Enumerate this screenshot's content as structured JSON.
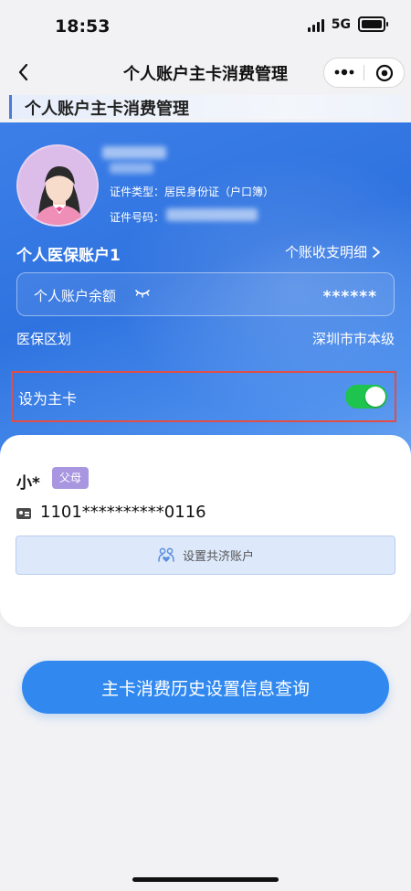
{
  "status_bar": {
    "time": "18:53",
    "network": "5G"
  },
  "nav": {
    "title": "个人账户主卡消费管理"
  },
  "subheader": {
    "title": "个人账户主卡消费管理"
  },
  "profile": {
    "id_type": "证件类型：居民身份证（户口簿）",
    "id_number_label": "证件号码："
  },
  "account": {
    "name": "个人医保账户1",
    "detail_link": "个账收支明细",
    "balance_label": "个人账户余额",
    "balance_value": "******",
    "region_label": "医保区划",
    "region_value": "深圳市市本级"
  },
  "main_card": {
    "label": "设为主卡",
    "enabled": true
  },
  "member": {
    "name": "小*",
    "relation": "父母",
    "id_number": "1101**********0116",
    "shared_button": "设置共济账户"
  },
  "query_button": "主卡消费历史设置信息查询",
  "colors": {
    "primary": "#3189f0",
    "toggle_on": "#1ec44e",
    "highlight": "#e24d45",
    "badge": "#a996e1"
  }
}
